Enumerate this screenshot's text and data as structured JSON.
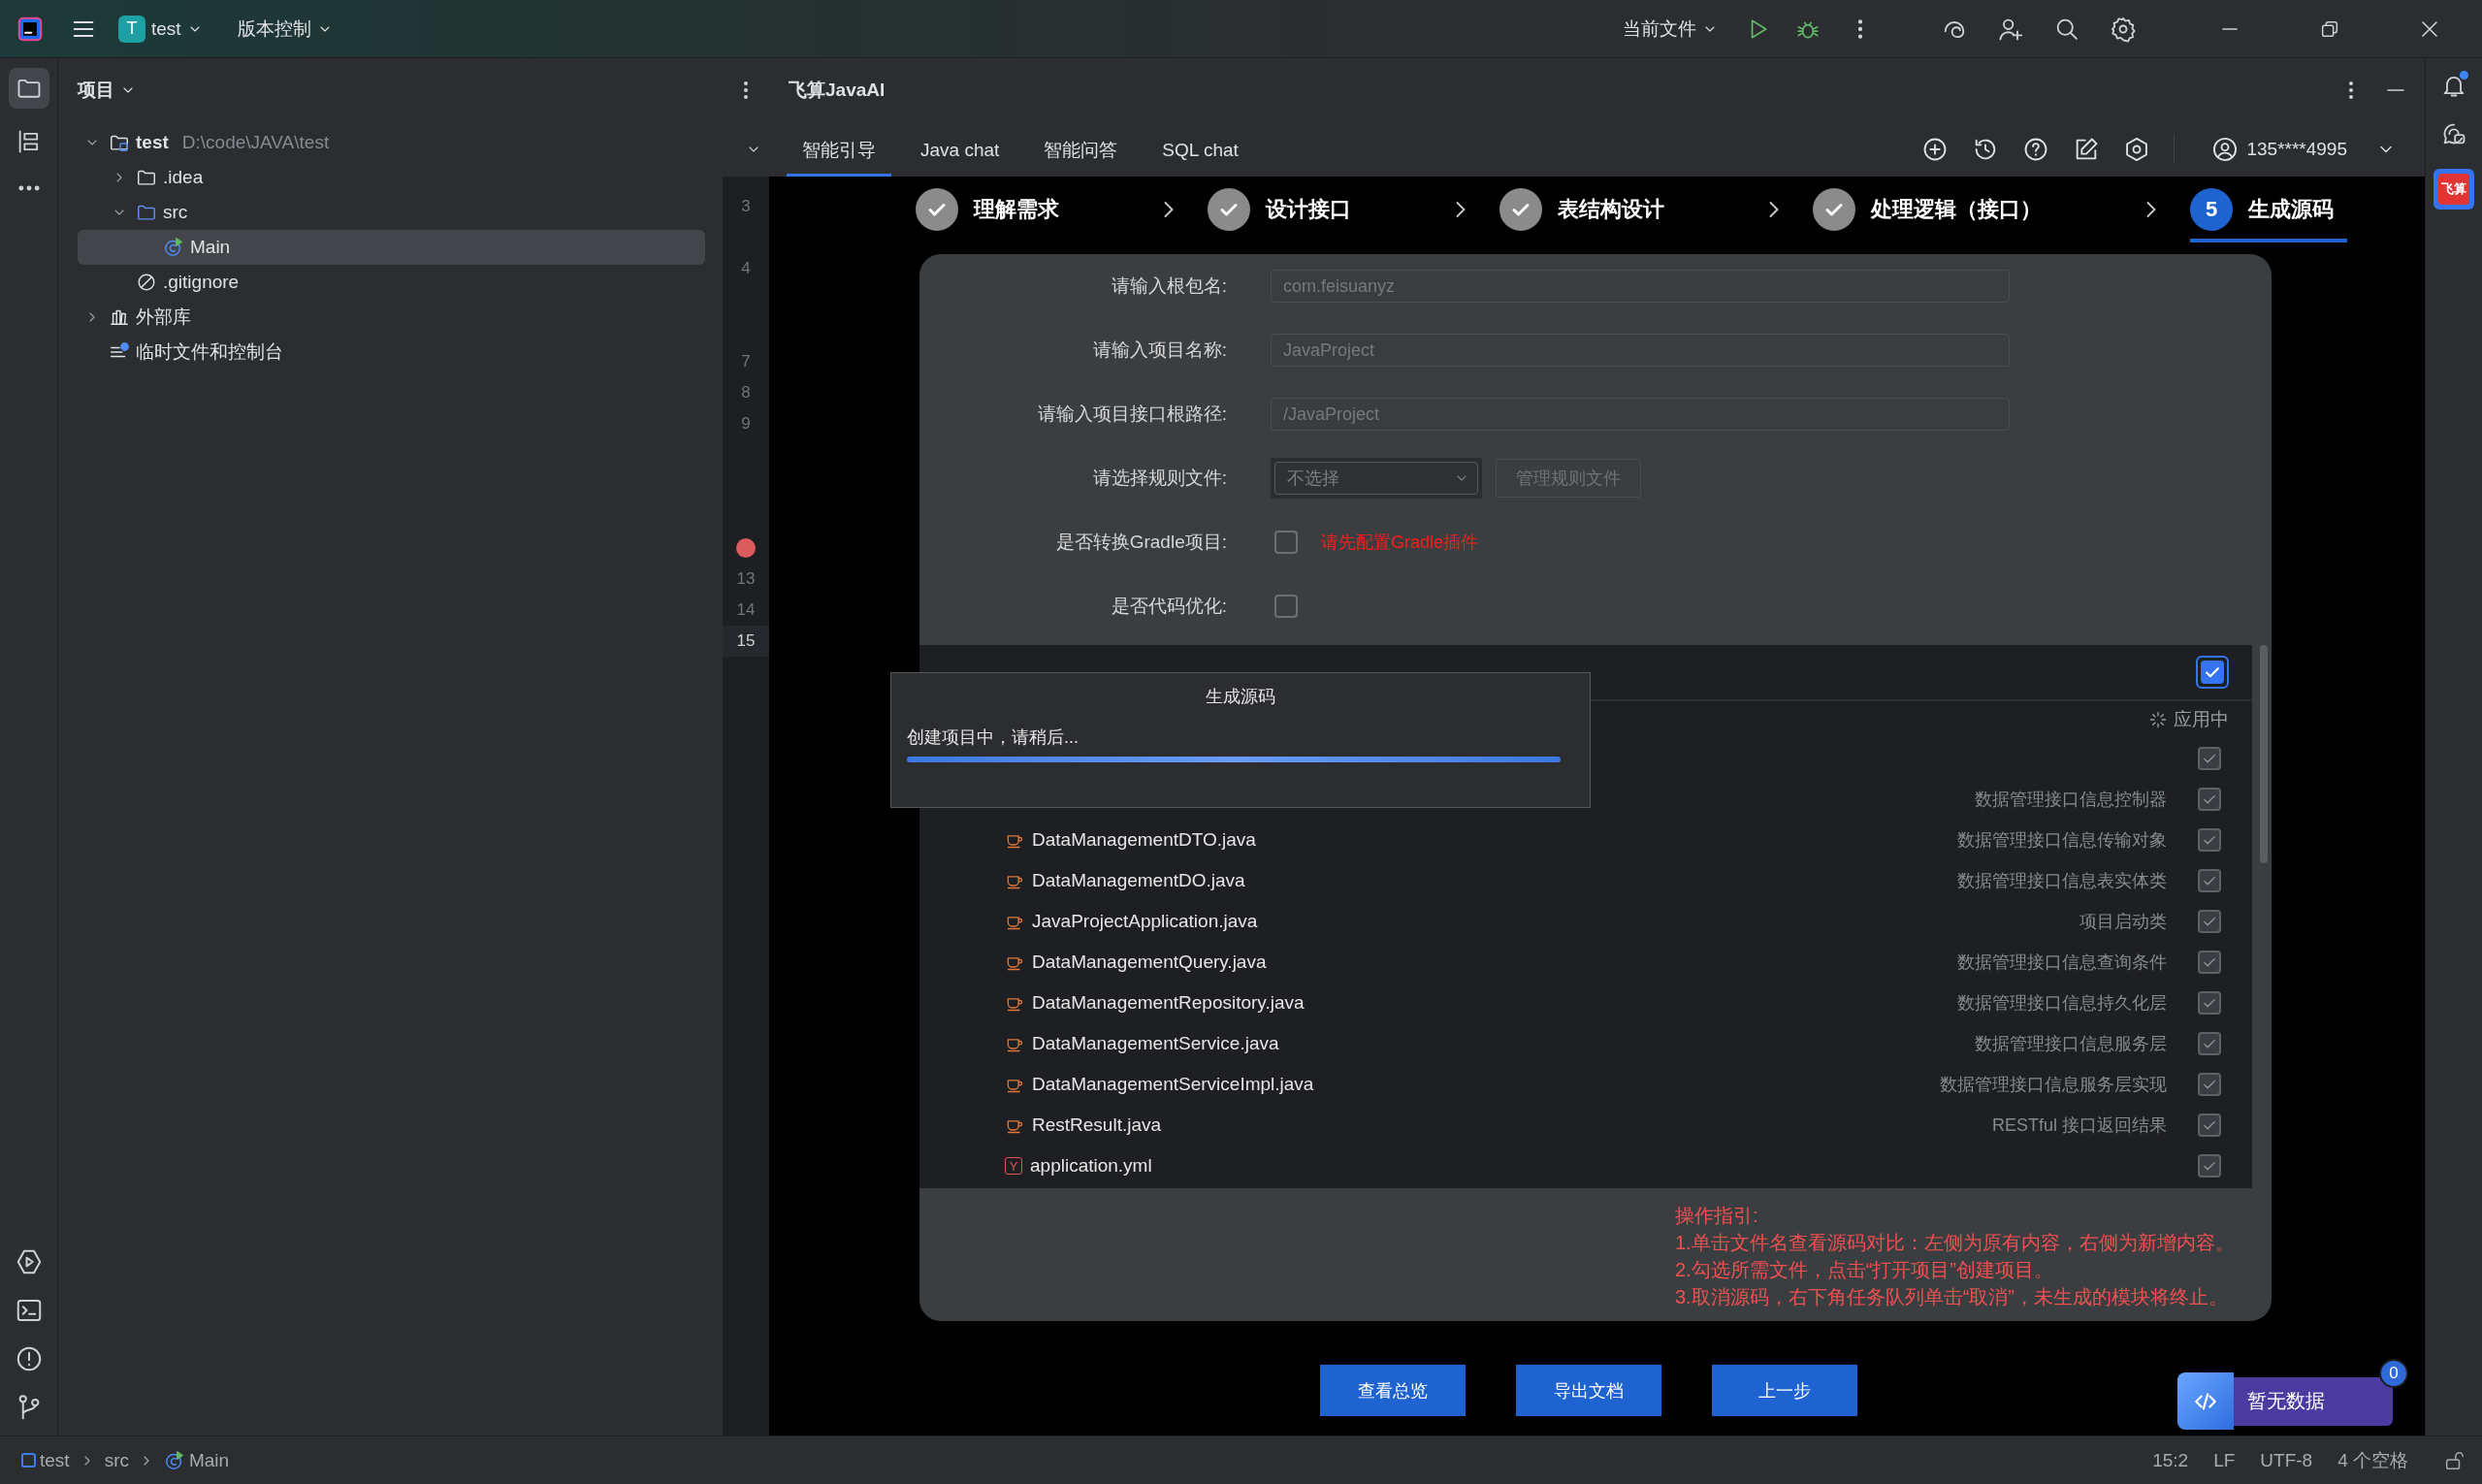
{
  "title_bar": {
    "project": {
      "initial": "T",
      "name": "test"
    },
    "vcs": "版本控制",
    "run_config": "当前文件"
  },
  "project_panel": {
    "title": "项目",
    "tree": [
      {
        "name": "test",
        "path": "D:\\code\\JAVA\\test",
        "kind": "module",
        "expanded": true,
        "selected": false,
        "children": [
          {
            "name": ".idea",
            "kind": "folder",
            "expanded": false,
            "selected": false
          },
          {
            "name": "src",
            "kind": "source",
            "expanded": true,
            "selected": false,
            "children": [
              {
                "name": "Main",
                "kind": "class",
                "selected": true
              }
            ]
          },
          {
            "name": ".gitignore",
            "kind": "ignore",
            "selected": false
          }
        ]
      },
      {
        "name": "外部库",
        "kind": "library",
        "expanded": false,
        "selected": false
      },
      {
        "name": "临时文件和控制台",
        "kind": "scratch",
        "selected": false
      }
    ]
  },
  "gutter": {
    "lines": [
      {
        "kind": "number",
        "number": "3",
        "current": false
      },
      {
        "kind": "blank"
      },
      {
        "kind": "number",
        "number": "4",
        "current": false
      },
      {
        "kind": "blank"
      },
      {
        "kind": "blank"
      },
      {
        "kind": "number",
        "number": "7",
        "current": false
      },
      {
        "kind": "number",
        "number": "8",
        "current": false
      },
      {
        "kind": "number",
        "number": "9",
        "current": false
      },
      {
        "kind": "blank"
      },
      {
        "kind": "blank"
      },
      {
        "kind": "blank"
      },
      {
        "kind": "breakpoint"
      },
      {
        "kind": "number",
        "number": "13",
        "current": false
      },
      {
        "kind": "number",
        "number": "14",
        "current": false
      },
      {
        "kind": "number",
        "number": "15",
        "current": true
      }
    ]
  },
  "plugin": {
    "title": "飞算JavaAI",
    "tabs": [
      {
        "label": "智能引导",
        "selected": true
      },
      {
        "label": "Java chat",
        "selected": false
      },
      {
        "label": "智能问答",
        "selected": false
      },
      {
        "label": "SQL chat",
        "selected": false
      }
    ],
    "user": "135****4995",
    "steps": [
      {
        "label": "理解需求",
        "completed": true,
        "selected": false
      },
      {
        "label": "设计接口",
        "completed": true,
        "selected": false
      },
      {
        "label": "表结构设计",
        "completed": true,
        "selected": false
      },
      {
        "label": "处理逻辑（接口）",
        "completed": true,
        "selected": false
      },
      {
        "label": "生成源码",
        "completed": false,
        "selected": true,
        "number": "5"
      }
    ],
    "form": {
      "rows": [
        {
          "kind": "text",
          "label": "请输入根包名:",
          "placeholder": "com.feisuanyz"
        },
        {
          "kind": "text",
          "label": "请输入项目名称:",
          "placeholder": "JavaProject"
        },
        {
          "kind": "text",
          "label": "请输入项目接口根路径:",
          "placeholder": "/JavaProject"
        },
        {
          "kind": "select",
          "label": "请选择规则文件:",
          "value": "不选择",
          "button": "管理规则文件"
        },
        {
          "kind": "checkbox",
          "label": "是否转换Gradle项目:",
          "checked": false,
          "warning": "请先配置Gradle插件"
        },
        {
          "kind": "checkbox",
          "label": "是否代码优化:",
          "checked": false
        }
      ]
    },
    "files": {
      "select_all": true,
      "status": "应用中",
      "items": [
        {
          "checked": true
        },
        {
          "description": "数据管理接口信息控制器",
          "checked": true
        },
        {
          "kind": "java",
          "name": "DataManagementDTO.java",
          "description": "数据管理接口信息传输对象",
          "checked": true
        },
        {
          "kind": "java",
          "name": "DataManagementDO.java",
          "description": "数据管理接口信息表实体类",
          "checked": true
        },
        {
          "kind": "java",
          "name": "JavaProjectApplication.java",
          "description": "项目启动类",
          "checked": true
        },
        {
          "kind": "java",
          "name": "DataManagementQuery.java",
          "description": "数据管理接口信息查询条件",
          "checked": true
        },
        {
          "kind": "java",
          "name": "DataManagementRepository.java",
          "description": "数据管理接口信息持久化层",
          "checked": true
        },
        {
          "kind": "java",
          "name": "DataManagementService.java",
          "description": "数据管理接口信息服务层",
          "checked": true
        },
        {
          "kind": "java",
          "name": "DataManagementServiceImpl.java",
          "description": "数据管理接口信息服务层实现",
          "checked": true
        },
        {
          "kind": "java",
          "name": "RestResult.java",
          "description": "RESTful 接口返回结果",
          "checked": true
        },
        {
          "kind": "yaml",
          "badge": "Y",
          "name": "application.yml",
          "checked": true
        }
      ]
    },
    "guide": {
      "title": "操作指引:",
      "lines": [
        "1.单击文件名查看源码对比：左侧为原有内容，右侧为新增内容。",
        "2.勾选所需文件，点击“打开项目”创建项目。",
        "3.取消源码，右下角任务队列单击“取消”，未生成的模块将终止。"
      ]
    },
    "buttons": [
      "查看总览",
      "导出文档",
      "上一步"
    ],
    "task_queue": {
      "label": "暂无数据",
      "count": "0"
    },
    "dialog": {
      "title": "生成源码",
      "message": "创建项目中，请稍后...",
      "progress": {
        "level": 1
      }
    }
  },
  "right_strip": {
    "logo": "飞算",
    "notification": true
  },
  "status_bar": {
    "breadcrumbs": [
      {
        "kind": "module",
        "label": "test"
      },
      {
        "kind": "folder",
        "label": "src"
      },
      {
        "kind": "class",
        "label": "Main"
      }
    ],
    "position": "15:2",
    "line_ending": "LF",
    "encoding": "UTF-8",
    "indent": "4 个空格"
  }
}
